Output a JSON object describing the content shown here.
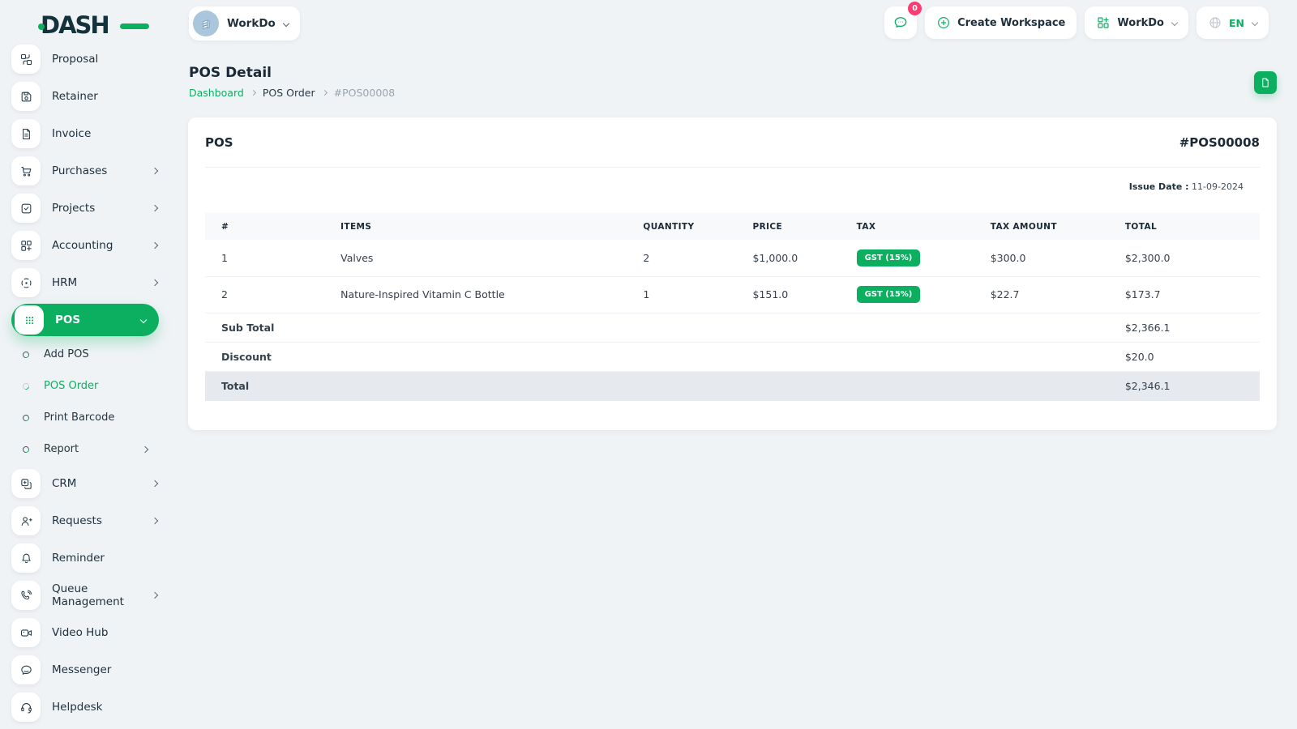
{
  "colors": {
    "primary": "#0caf60",
    "badge_red": "#ff3a6e"
  },
  "brand": {
    "name": "DASH"
  },
  "workspace": {
    "name": "WorkDo"
  },
  "header": {
    "messages_badge": "0",
    "create_workspace_label": "Create Workspace",
    "workdo_label": "WorkDo",
    "language": "EN"
  },
  "sidebar": {
    "items": [
      {
        "label": "Proposal"
      },
      {
        "label": "Retainer"
      },
      {
        "label": "Invoice"
      },
      {
        "label": "Purchases"
      },
      {
        "label": "Projects"
      },
      {
        "label": "Accounting"
      },
      {
        "label": "HRM"
      },
      {
        "label": "POS"
      }
    ],
    "pos_submenu": [
      {
        "label": "Add POS"
      },
      {
        "label": "POS Order"
      },
      {
        "label": "Print Barcode"
      },
      {
        "label": "Report"
      }
    ],
    "items_bottom": [
      {
        "label": "CRM"
      },
      {
        "label": "Requests"
      },
      {
        "label": "Reminder"
      },
      {
        "label": "Queue Management"
      },
      {
        "label": "Video Hub"
      },
      {
        "label": "Messenger"
      },
      {
        "label": "Helpdesk"
      }
    ]
  },
  "page": {
    "title": "POS Detail",
    "breadcrumb": {
      "home": "Dashboard",
      "section": "POS Order",
      "current": "#POS00008"
    }
  },
  "pos_card": {
    "title": "POS",
    "number": "#POS00008",
    "issue_date_label": "Issue Date :",
    "issue_date": " 11-09-2024",
    "table": {
      "headers": [
        "#",
        "ITEMS",
        "QUANTITY",
        "PRICE",
        "TAX",
        "TAX AMOUNT",
        "TOTAL"
      ],
      "rows": [
        {
          "no": "1",
          "item": "Valves",
          "qty": "2",
          "price": "$1,000.0",
          "tax": "GST (15%)",
          "tax_amount": "$300.0",
          "total": "$2,300.0"
        },
        {
          "no": "2",
          "item": "Nature-Inspired Vitamin C Bottle",
          "qty": "1",
          "price": "$151.0",
          "tax": "GST (15%)",
          "tax_amount": "$22.7",
          "total": "$173.7"
        }
      ],
      "summary": [
        {
          "label": "Sub Total",
          "value": "$2,366.1"
        },
        {
          "label": "Discount",
          "value": "$20.0"
        },
        {
          "label": "Total",
          "value": "$2,346.1"
        }
      ]
    }
  }
}
